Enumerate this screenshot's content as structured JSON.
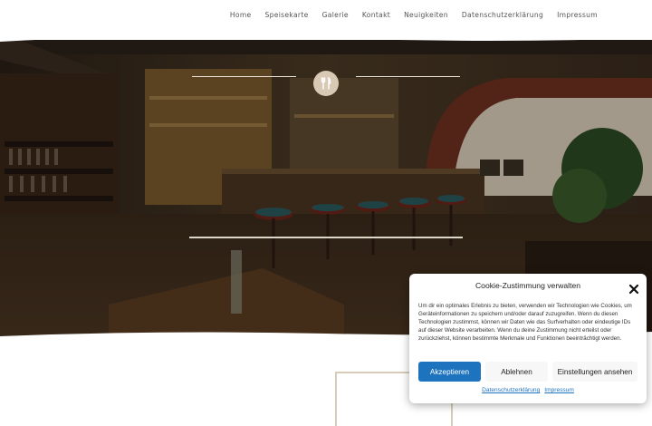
{
  "nav": {
    "items": [
      {
        "label": "Home"
      },
      {
        "label": "Speisekarte"
      },
      {
        "label": "Galerie"
      },
      {
        "label": "Kontakt"
      },
      {
        "label": "Neuigkeiten"
      },
      {
        "label": "Datenschutzerklärung"
      },
      {
        "label": "Impressum"
      }
    ]
  },
  "hero": {
    "icon": "fork-knife-icon",
    "accent_color": "#d8c9b4"
  },
  "cookie": {
    "title": "Cookie-Zustimmung verwalten",
    "body": "Um dir ein optimales Erlebnis zu bieten, verwenden wir Technologien wie Cookies, um Geräteinformationen zu speichern und/oder darauf zuzugreifen. Wenn du diesen Technologien zustimmst, können wir Daten wie das Surfverhalten oder eindeutige IDs auf dieser Website verarbeiten. Wenn du deine Zustimmung nicht erteilst oder zurückziehst, können bestimmte Merkmale und Funktionen beeinträchtigt werden.",
    "accept_label": "Akzeptieren",
    "deny_label": "Ablehnen",
    "prefs_label": "Einstellungen ansehen",
    "privacy_link": "Datenschutzerklärung",
    "imprint_link": "Impressum",
    "accent_color": "#1e73be"
  }
}
